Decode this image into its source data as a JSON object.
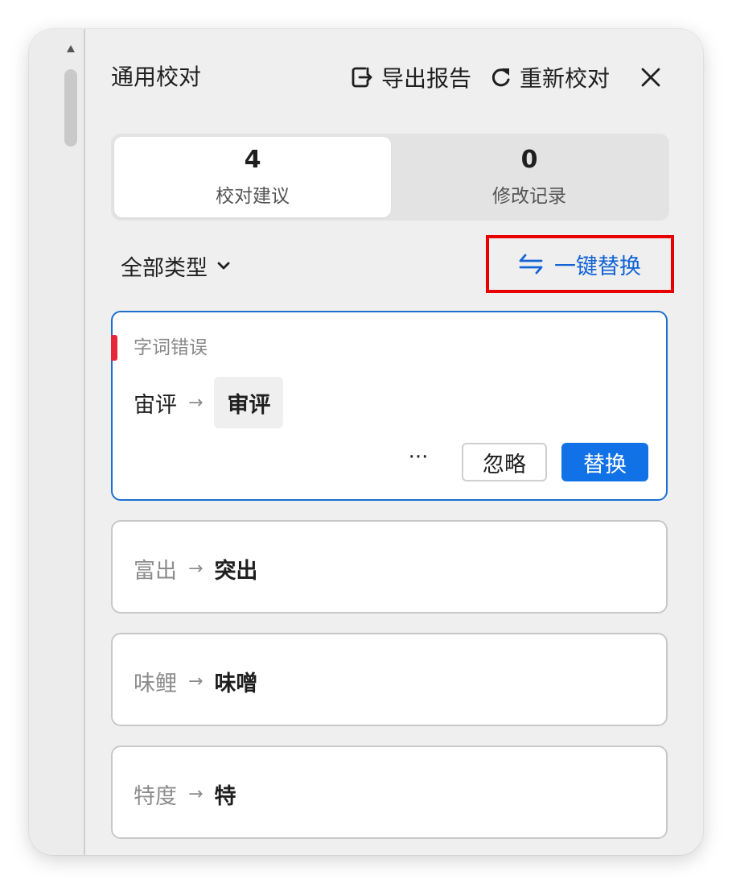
{
  "header": {
    "title": "通用校对",
    "export_label": "导出报告",
    "recheck_label": "重新校对"
  },
  "tabs": [
    {
      "count": "4",
      "label": "校对建议"
    },
    {
      "count": "0",
      "label": "修改记录"
    }
  ],
  "filter": {
    "label": "全部类型"
  },
  "replace_all": {
    "label": "一键替换"
  },
  "suggestions": [
    {
      "type": "字词错误",
      "original": "宙评",
      "suggestion": "审评",
      "more": "···",
      "ignore": "忽略",
      "replace": "替换"
    },
    {
      "original": "富出",
      "suggestion": "突出"
    },
    {
      "original": "味鲤",
      "suggestion": "味噌"
    },
    {
      "original": "特度",
      "suggestion": "特"
    }
  ],
  "colors": {
    "accent": "#1171e6",
    "highlight_border": "#e60000",
    "error_marker": "#e4273a",
    "panel_bg": "#efefef"
  },
  "icons": {
    "export": "export-icon",
    "recheck": "refresh-icon",
    "close": "close-icon",
    "filter": "chevron-down-icon",
    "replace_all": "swap-arrows-icon",
    "scroll": "scroll-up-arrow-icon"
  }
}
